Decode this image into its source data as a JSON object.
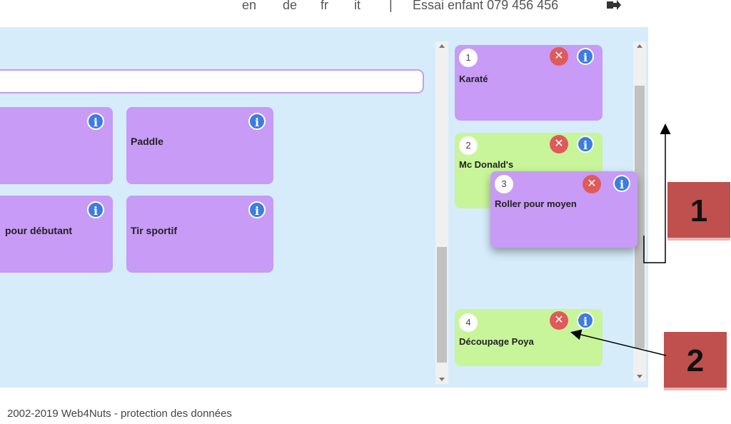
{
  "topbar": {
    "languages": [
      "en",
      "de",
      "fr",
      "it"
    ],
    "separator": "|",
    "user": "Essai enfant 079 456 456",
    "logout_icon": "logout-icon"
  },
  "search": {
    "value": "",
    "placeholder": ""
  },
  "activities": [
    {
      "title": ""
    },
    {
      "title": "Paddle"
    },
    {
      "title": "pour débutant"
    },
    {
      "title": "Tir sportif"
    }
  ],
  "selected": [
    {
      "number": "1",
      "title": "Karaté",
      "color": "#c79bf6"
    },
    {
      "number": "2",
      "title": "Mc Donald's",
      "color": "#c8f59a"
    },
    {
      "number": "3",
      "title": "Roller pour moyen",
      "color": "#c79bf6"
    },
    {
      "number": "4",
      "title": "Découpage Poya",
      "color": "#c8f59a"
    }
  ],
  "icons": {
    "info": "i",
    "delete": "✕"
  },
  "footer": "2002-2019 Web4Nuts - protection des données",
  "callouts": [
    "1",
    "2"
  ]
}
